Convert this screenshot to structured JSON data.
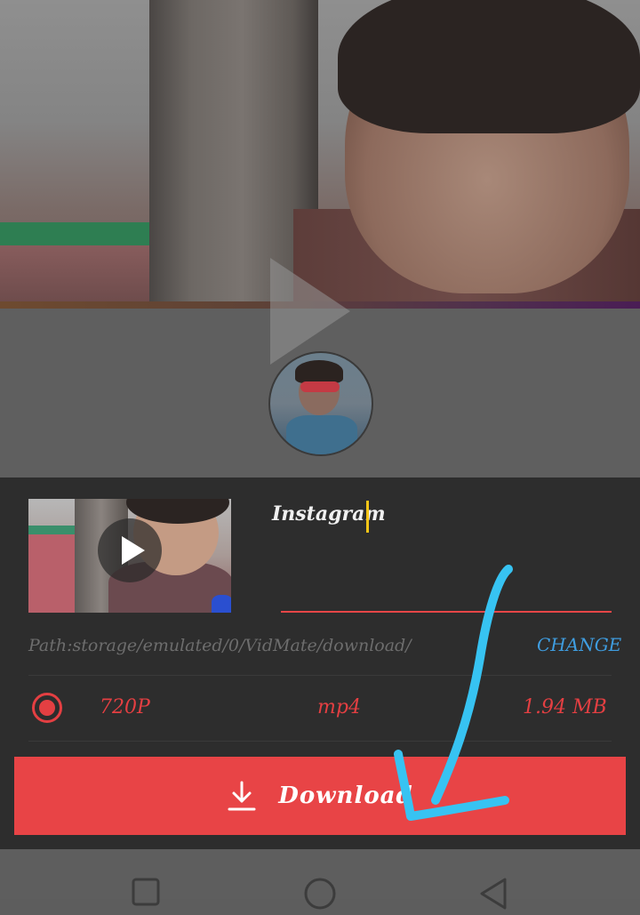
{
  "video": {
    "title": "Instagram",
    "path": "Path:storage/emulated/0/VidMate/download/",
    "change_label": "CHANGE"
  },
  "format_option": {
    "resolution": "720P",
    "format": "mp4",
    "size": "1.94 MB",
    "selected": true
  },
  "download": {
    "label": "Download",
    "icon": "download-icon"
  },
  "navigation": {
    "buttons": [
      "recent-apps-icon",
      "home-icon",
      "back-icon"
    ]
  },
  "colors": {
    "accent": "#e84446",
    "link": "#3f9de0",
    "cursor": "#f5c518",
    "sheet_bg": "#2d2d2d"
  }
}
